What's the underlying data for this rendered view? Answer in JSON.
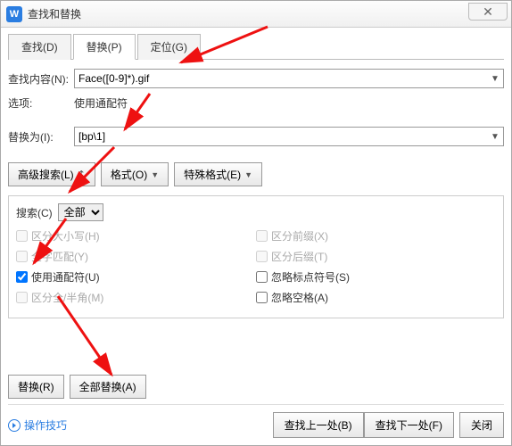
{
  "title": "查找和替换",
  "tabs": {
    "find": "查找(D)",
    "replace": "替换(P)",
    "goto": "定位(G)"
  },
  "findRow": {
    "label": "查找内容(N):",
    "value": "Face([0-9]*).gif"
  },
  "optionsRow": {
    "label": "选项:",
    "text": "使用通配符"
  },
  "replaceRow": {
    "label": "替换为(I):",
    "value": "[bp\\1]"
  },
  "buttons": {
    "advanced": "高级搜索(L)",
    "format": "格式(O)",
    "special": "特殊格式(E)"
  },
  "search": {
    "label": "搜索(C)",
    "scope": "全部"
  },
  "checks": {
    "matchCase": "区分大小写(H)",
    "wholeWord": "全字匹配(Y)",
    "wildcards": "使用通配符(U)",
    "fullHalf": "区分全/半角(M)",
    "prefix": "区分前缀(X)",
    "suffix": "区分后缀(T)",
    "punctuation": "忽略标点符号(S)",
    "spaces": "忽略空格(A)"
  },
  "actions": {
    "replaceOne": "替换(R)",
    "replaceAll": "全部替换(A)"
  },
  "footer": {
    "tips": "操作技巧",
    "findPrev": "查找上一处(B)",
    "findNext": "查找下一处(F)",
    "close": "关闭"
  }
}
